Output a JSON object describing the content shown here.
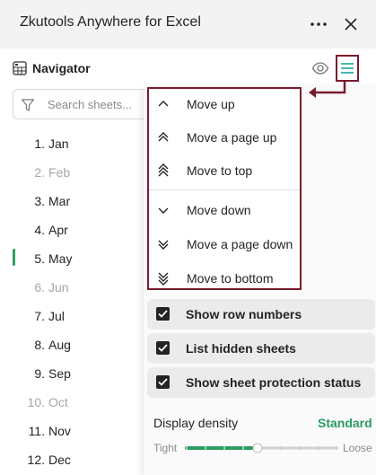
{
  "app": {
    "title": "Zkutools Anywhere for Excel"
  },
  "navigator": {
    "title": "Navigator",
    "search": {
      "placeholder": "Search sheets...",
      "value": ""
    },
    "sheets": [
      {
        "number": "1.",
        "name": "Jan",
        "hidden": false
      },
      {
        "number": "2.",
        "name": "Feb",
        "hidden": true
      },
      {
        "number": "3.",
        "name": "Mar",
        "hidden": false
      },
      {
        "number": "4.",
        "name": "Apr",
        "hidden": false
      },
      {
        "number": "5.",
        "name": "May",
        "hidden": false,
        "active": true
      },
      {
        "number": "6.",
        "name": "Jun",
        "hidden": true
      },
      {
        "number": "7.",
        "name": "Jul",
        "hidden": false
      },
      {
        "number": "8.",
        "name": "Aug",
        "hidden": false
      },
      {
        "number": "9.",
        "name": "Sep",
        "hidden": false
      },
      {
        "number": "10.",
        "name": "Oct",
        "hidden": true
      },
      {
        "number": "11.",
        "name": "Nov",
        "hidden": false
      },
      {
        "number": "12.",
        "name": "Dec",
        "hidden": false
      }
    ]
  },
  "menu": {
    "move_items": [
      {
        "label": "Move up",
        "icon": "chevron-up-icon"
      },
      {
        "label": "Move a page up",
        "icon": "double-chevron-up-icon"
      },
      {
        "label": "Move to top",
        "icon": "triple-chevron-up-icon"
      },
      {
        "label": "Move down",
        "icon": "chevron-down-icon"
      },
      {
        "label": "Move a page down",
        "icon": "double-chevron-down-icon"
      },
      {
        "label": "Move to bottom",
        "icon": "triple-chevron-down-icon"
      }
    ],
    "options": [
      {
        "label": "Show row numbers",
        "checked": true
      },
      {
        "label": "List hidden sheets",
        "checked": true
      },
      {
        "label": "Show sheet protection status",
        "checked": true
      }
    ],
    "density": {
      "label": "Display density",
      "value": "Standard",
      "min_label": "Tight",
      "max_label": "Loose",
      "level": 0.47
    }
  },
  "colors": {
    "accent": "#2c9c61",
    "highlight_frame": "#7a1c2c",
    "hidden_text": "#a6a6a6",
    "teal_icon": "#1aa6a0"
  }
}
